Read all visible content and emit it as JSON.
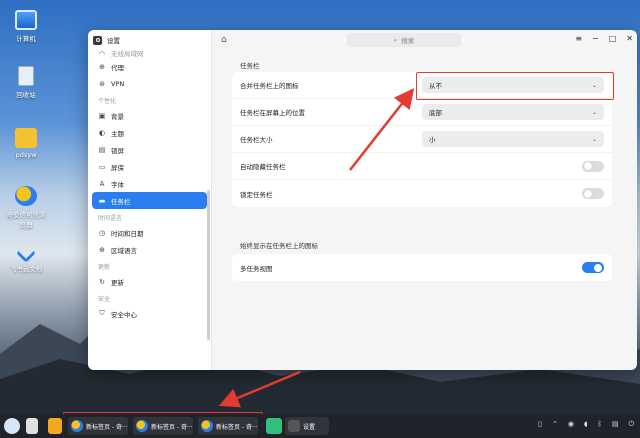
{
  "desktop": {
    "icons": [
      {
        "label": "计算机",
        "icon": "monitor-icon"
      },
      {
        "label": "回收站",
        "icon": "trash-icon"
      },
      {
        "label": "pdsyw",
        "icon": "folder-icon"
      },
      {
        "label": "奇安信可信浏览器",
        "icon": "browser-icon"
      },
      {
        "label": "飞书云文档",
        "icon": "cloud-doc-icon"
      }
    ]
  },
  "window": {
    "title": "设置",
    "search_placeholder": "搜索",
    "sidebar": {
      "partial_top": "无线局域网",
      "items_net": [
        {
          "label": "代理",
          "icon": "proxy-icon"
        },
        {
          "label": "VPN",
          "icon": "vpn-icon"
        }
      ],
      "head_personal": "个性化",
      "items_personal": [
        {
          "label": "背景",
          "icon": "image-icon"
        },
        {
          "label": "主题",
          "icon": "palette-icon"
        },
        {
          "label": "锁屏",
          "icon": "lock-icon"
        },
        {
          "label": "屏保",
          "icon": "screensaver-icon"
        },
        {
          "label": "字体",
          "icon": "font-icon"
        },
        {
          "label": "任务栏",
          "icon": "taskbar-icon",
          "active": true
        }
      ],
      "head_time": "时间语言",
      "items_time": [
        {
          "label": "时间和日期",
          "icon": "clock-icon"
        },
        {
          "label": "区域语言",
          "icon": "globe-icon"
        }
      ],
      "head_update": "更新",
      "items_update": [
        {
          "label": "更新",
          "icon": "update-icon"
        }
      ],
      "head_security": "安全",
      "items_security": [
        {
          "label": "安全中心",
          "icon": "shield-icon"
        }
      ]
    },
    "main": {
      "section1_title": "任务栏",
      "rows": [
        {
          "label": "合并任务栏上的图标",
          "type": "select",
          "value": "从不"
        },
        {
          "label": "任务栏在屏幕上的位置",
          "type": "select",
          "value": "底部"
        },
        {
          "label": "任务栏大小",
          "type": "select",
          "value": "小"
        },
        {
          "label": "自动隐藏任务栏",
          "type": "toggle",
          "on": false
        },
        {
          "label": "锁定任务栏",
          "type": "toggle",
          "on": false
        }
      ],
      "section2_title": "始终显示在任务栏上的图标",
      "rows2": [
        {
          "label": "多任务视图",
          "type": "toggle",
          "on": true
        }
      ]
    }
  },
  "taskbar": {
    "tabs": [
      "新标签页 - 奇···",
      "新标签页 - 奇···",
      "新标签页 - 奇···"
    ],
    "settings_label": "设置"
  },
  "colors": {
    "accent": "#2b7ef0",
    "highlight": "#e23b2f"
  }
}
